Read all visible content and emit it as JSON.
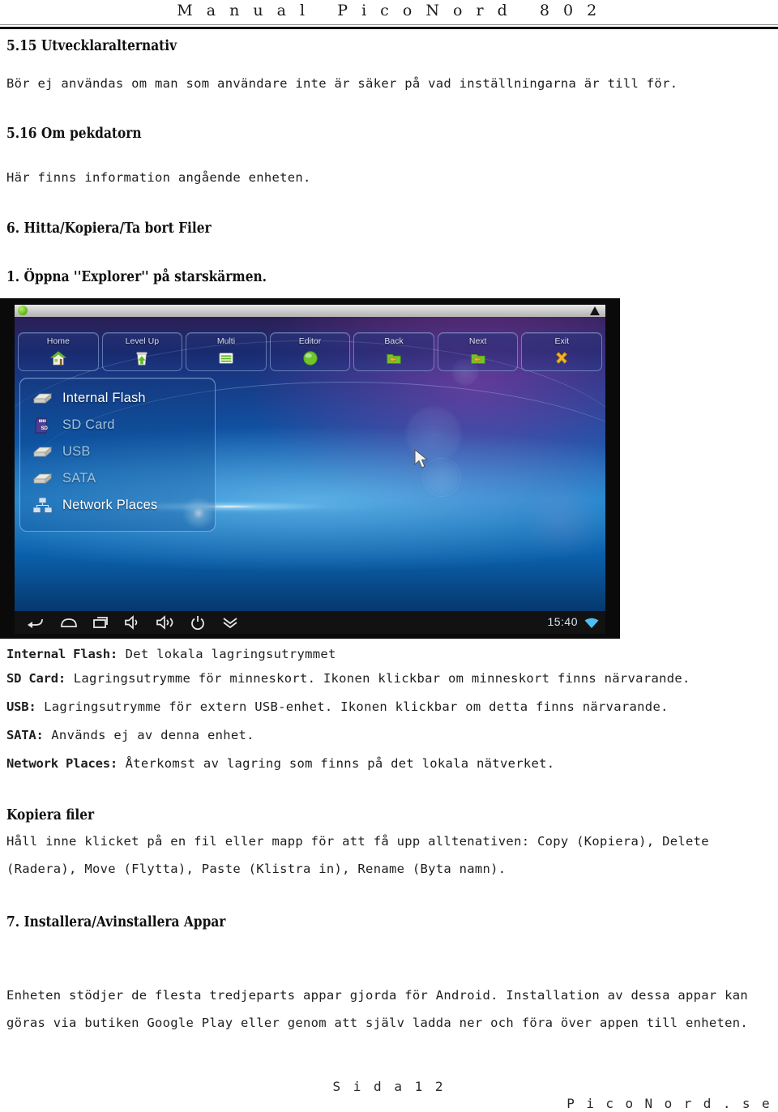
{
  "header": {
    "title": "M a n u a l   P i c o N o r d   8 0 2"
  },
  "sections": {
    "s515_heading": "5.15 Utvecklaralternativ",
    "s515_body": "Bör ej användas om man som användare inte är säker på vad inställningarna är till för.",
    "s516_heading": "5.16 Om pekdatorn",
    "s516_body": "Här finns information angående enheten.",
    "s6_heading": "6. Hitta/Kopiera/Ta bort Filer",
    "s6_step1": "1. Öppna ''Explorer'' på starskärmen.",
    "kopiera_heading": "Kopiera filer",
    "kopiera_line1": "Håll inne klicket på en fil eller mapp för att få upp alltenativen: Copy (Kopiera), Delete",
    "kopiera_line2": "(Radera), Move (Flytta), Paste (Klistra in), Rename (Byta namn).",
    "s7_heading": "7. Installera/Avinstallera Appar",
    "s7_line1": "Enheten stödjer de flesta tredjeparts appar gjorda för Android. Installation av dessa appar kan",
    "s7_line2": "göras via butiken Google Play eller genom att själv ladda ner och föra över appen till enheten."
  },
  "definitions": [
    {
      "term": "Internal Flash:",
      "desc": " Det lokala lagringsutrymmet"
    },
    {
      "term": "SD Card:",
      "desc": " Lagringsutrymme för minneskort. Ikonen klickbar om minneskort finns närvarande."
    },
    {
      "term": "USB:",
      "desc": " Lagringsutrymme för extern USB-enhet. Ikonen klickbar om detta finns närvarande."
    },
    {
      "term": "SATA:",
      "desc": " Används ej av denna enhet."
    },
    {
      "term": "Network Places:",
      "desc": " Återkomst av lagring som finns på det lokala nätverket."
    }
  ],
  "screenshot": {
    "toolbar": [
      {
        "label": "Home",
        "icon": "house-icon"
      },
      {
        "label": "Level Up",
        "icon": "folder-up-icon"
      },
      {
        "label": "Multi",
        "icon": "list-icon"
      },
      {
        "label": "Editor",
        "icon": "green-circle-icon"
      },
      {
        "label": "Back",
        "icon": "folder-back-icon"
      },
      {
        "label": "Next",
        "icon": "folder-next-icon"
      },
      {
        "label": "Exit",
        "icon": "x-icon"
      }
    ],
    "files": [
      {
        "label": "Internal Flash",
        "icon": "drive-icon",
        "active": true
      },
      {
        "label": "SD Card",
        "icon": "sdcard-icon",
        "active": false
      },
      {
        "label": "USB",
        "icon": "drive-icon",
        "active": false
      },
      {
        "label": "SATA",
        "icon": "drive-icon",
        "active": false
      },
      {
        "label": "Network Places",
        "icon": "network-icon",
        "active": true
      }
    ],
    "navbar": [
      {
        "icon": "back-arrow-icon"
      },
      {
        "icon": "home-icon"
      },
      {
        "icon": "recents-icon"
      },
      {
        "icon": "volume-down-icon"
      },
      {
        "icon": "volume-up-icon"
      },
      {
        "icon": "power-icon"
      },
      {
        "icon": "chevron-double-down-icon"
      }
    ],
    "clock": "15:40",
    "wifi_icon": "wifi-icon"
  },
  "footer": {
    "page": "S i d a   1 2",
    "site": "P i c o N o r d . s e"
  },
  "colors": {
    "rule": "#111111",
    "wallpaper_blue": "#0f57a8",
    "accent_green": "#5fb21a"
  }
}
